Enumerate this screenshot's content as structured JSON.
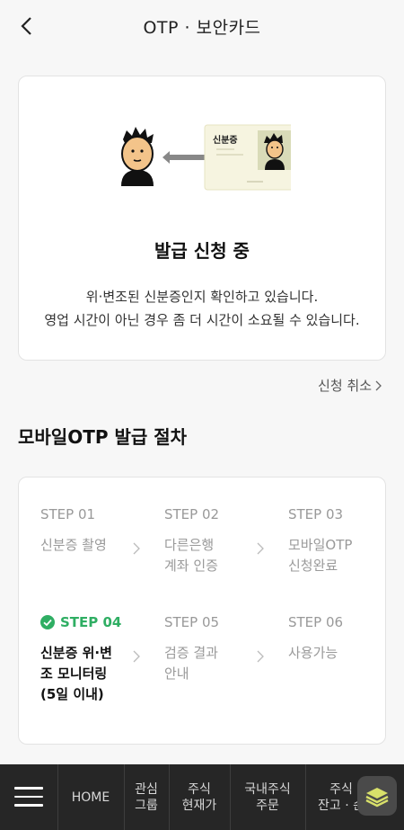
{
  "header": {
    "title": "OTP · 보안카드"
  },
  "status": {
    "illust_card_label": "신분증",
    "title": "발급 신청 중",
    "desc_line1": "위·변조된 신분증인지 확인하고 있습니다.",
    "desc_line2": "영업 시간이 아닌 경우 좀 더 시간이 소요될 수 있습니다."
  },
  "cancel": {
    "label": "신청 취소"
  },
  "procedure": {
    "title": "모바일OTP 발급 절차",
    "steps": [
      {
        "label": "STEP 01",
        "text": "신분증 촬영",
        "active": false
      },
      {
        "label": "STEP 02",
        "text": "다른은행\n계좌 인증",
        "active": false
      },
      {
        "label": "STEP 03",
        "text": "모바일OTP\n신청완료",
        "active": false
      },
      {
        "label": "STEP 04",
        "text": "신분증 위·변\n조 모니터링\n(5일 이내)",
        "active": true
      },
      {
        "label": "STEP 05",
        "text": "검증 결과\n안내",
        "active": false
      },
      {
        "label": "STEP 06",
        "text": "사용가능",
        "active": false
      }
    ]
  },
  "bottom_nav": {
    "items": [
      {
        "label": "HOME"
      },
      {
        "label": "관심\n그룹"
      },
      {
        "label": "주식\n현재가"
      },
      {
        "label": "국내주식\n주문"
      },
      {
        "label": "주식\n잔고 · 손"
      }
    ]
  },
  "colors": {
    "active_step": "#2fae63",
    "nav_bg": "#262626",
    "page_bg": "#f7f7f7"
  },
  "icons": [
    "back-arrow-icon",
    "chevron-right-icon",
    "check-circle-icon",
    "hamburger-menu-icon",
    "layers-icon"
  ]
}
